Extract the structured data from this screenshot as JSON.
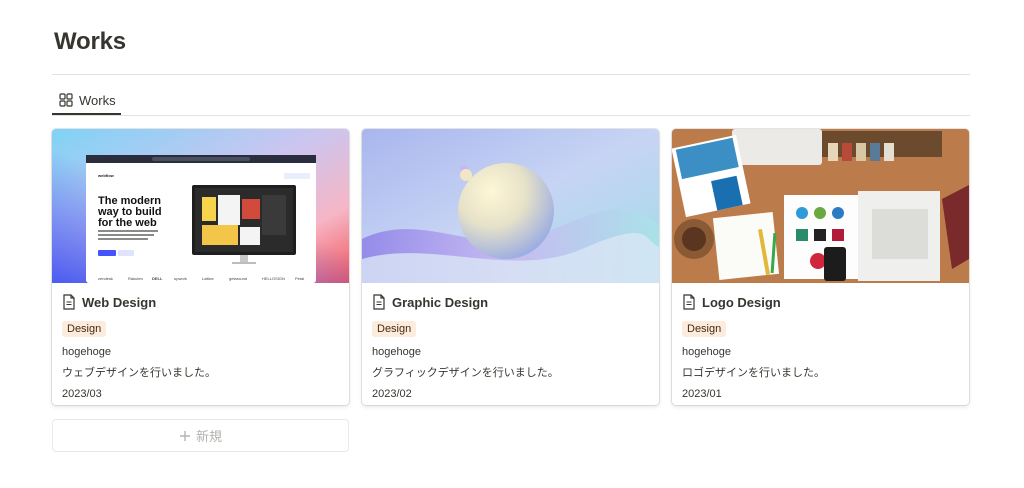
{
  "page": {
    "title": "Works"
  },
  "tabs": [
    {
      "label": "Works",
      "icon": "gallery-icon"
    }
  ],
  "cards": [
    {
      "title": "Web Design",
      "icon": "page-icon",
      "tag": "Design",
      "text1": "hogehoge",
      "text2": "ウェブデザインを行いました。",
      "date": "2023/03",
      "cover": {
        "headline_l1": "The modern",
        "headline_l2": "way to build",
        "headline_l3": "for the web",
        "logos": [
          "zendesk",
          "Rakuten",
          "DELL",
          "upwork",
          "Lattice",
          "getaround",
          "HELLOSIGN",
          "Petal"
        ]
      }
    },
    {
      "title": "Graphic Design",
      "icon": "page-icon",
      "tag": "Design",
      "text1": "hogehoge",
      "text2": "グラフィックデザインを行いました。",
      "date": "2023/02"
    },
    {
      "title": "Logo Design",
      "icon": "page-icon",
      "tag": "Design",
      "text1": "hogehoge",
      "text2": "ロゴデザインを行いました。",
      "date": "2023/01"
    }
  ],
  "new_button": {
    "label": "新規",
    "icon": "plus-icon"
  },
  "colors": {
    "text": "#37352f",
    "tag_bg": "#fbecdd",
    "tag_text": "#49290e",
    "muted": "#b4b3af"
  }
}
